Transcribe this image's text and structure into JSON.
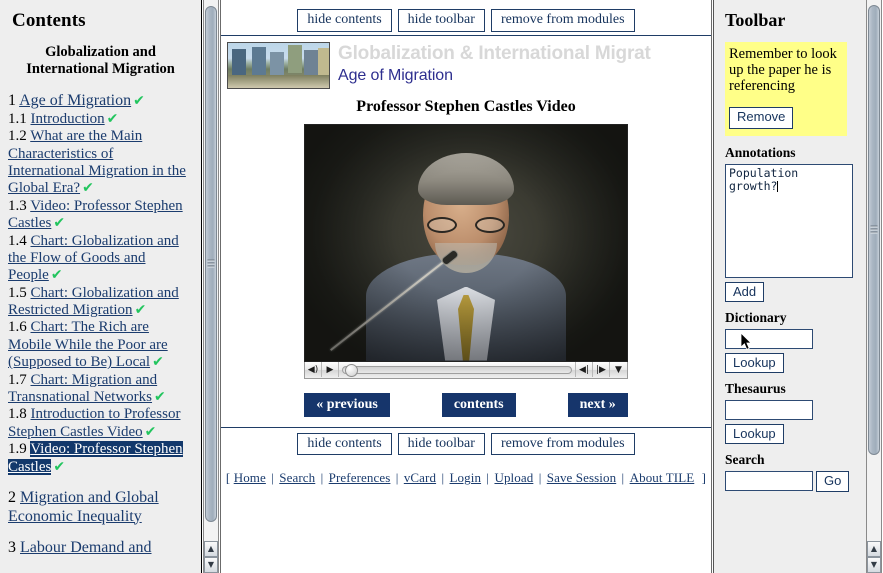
{
  "contents": {
    "heading": "Contents",
    "module_title_line1": "Globalization and",
    "module_title_line2": "International Migration",
    "items": [
      {
        "num": "1",
        "label": "Age of Migration",
        "level": 1,
        "done": true,
        "selected": false
      },
      {
        "num": "1.1",
        "label": "Introduction",
        "level": 2,
        "done": true,
        "selected": false
      },
      {
        "num": "1.2",
        "label": "What are the Main Characteristics of International Migration in the Global Era?",
        "level": 2,
        "done": true,
        "selected": false
      },
      {
        "num": "1.3",
        "label": "Video: Professor Stephen Castles",
        "level": 2,
        "done": true,
        "selected": false
      },
      {
        "num": "1.4",
        "label": "Chart: Globalization and the Flow of Goods and People",
        "level": 2,
        "done": true,
        "selected": false
      },
      {
        "num": "1.5",
        "label": "Chart: Globalization and Restricted Migration",
        "level": 2,
        "done": true,
        "selected": false
      },
      {
        "num": "1.6",
        "label": "Chart: The Rich are Mobile While the Poor are (Supposed to Be) Local",
        "level": 2,
        "done": true,
        "selected": false
      },
      {
        "num": "1.7",
        "label": "Chart: Migration and Transnational Networks",
        "level": 2,
        "done": true,
        "selected": false
      },
      {
        "num": "1.8",
        "label": "Introduction to Professor Stephen Castles Video",
        "level": 2,
        "done": true,
        "selected": false
      },
      {
        "num": "1.9",
        "label": "Video: Professor Stephen Castles",
        "level": 2,
        "done": true,
        "selected": true
      },
      {
        "num": "2",
        "label": "Migration and Global Economic Inequality",
        "level": 1,
        "done": false,
        "selected": false
      },
      {
        "num": "3",
        "label": "Labour Demand and",
        "level": 1,
        "done": false,
        "selected": false
      }
    ],
    "check_glyph": "✔"
  },
  "topbar": {
    "hide_contents": "hide contents",
    "hide_toolbar": "hide toolbar",
    "remove_from_modules": "remove from modules"
  },
  "banner": {
    "title": "Globalization & International Migrat",
    "subtitle": "Age of Migration",
    "image_name": "cityscape-banner-image"
  },
  "main": {
    "page_title": "Professor Stephen Castles Video",
    "video": {
      "name": "professor-stephen-castles-video",
      "volume_icon": "◀)",
      "play_icon": "▶",
      "step_back_icon": "◀|",
      "step_fwd_icon": "|▶",
      "menu_icon": "▼",
      "progress_percent": 1
    },
    "nav": {
      "previous": "« previous",
      "contents": "contents",
      "next": "next »"
    },
    "footer": {
      "open_bracket": "[",
      "close_bracket": "]",
      "separator": "|",
      "links": [
        "Home",
        "Search",
        "Preferences",
        "vCard",
        "Login",
        "Upload",
        "Save Session",
        "About TILE"
      ]
    }
  },
  "toolbar": {
    "heading": "Toolbar",
    "sticky_note": {
      "text": "Remember to look up the paper he is referencing",
      "remove_label": "Remove",
      "color": "#ffff88"
    },
    "annotations": {
      "label": "Annotations",
      "value": "Population growth?",
      "add_label": "Add"
    },
    "dictionary": {
      "label": "Dictionary",
      "value": "",
      "lookup_label": "Lookup"
    },
    "thesaurus": {
      "label": "Thesaurus",
      "value": "",
      "lookup_label": "Lookup"
    },
    "search": {
      "label": "Search",
      "value": "",
      "go_label": "Go"
    }
  },
  "scrollbars": {
    "up_arrow": "▲",
    "down_arrow": "▼"
  }
}
